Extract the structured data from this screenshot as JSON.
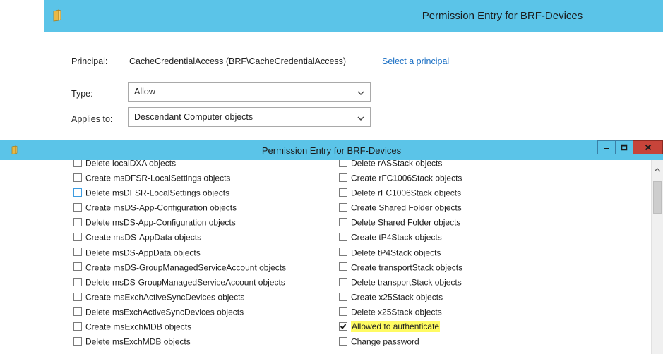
{
  "back_window": {
    "title": "Permission Entry for BRF-Devices",
    "principal_label": "Principal:",
    "principal_value": "CacheCredentialAccess (BRF\\CacheCredentialAccess)",
    "select_principal_link": "Select a principal",
    "type_label": "Type:",
    "type_value": "Allow",
    "applies_label": "Applies to:",
    "applies_value": "Descendant Computer objects"
  },
  "front_window": {
    "title": "Permission Entry for BRF-Devices",
    "left_column": [
      {
        "label": "Delete localDXA objects",
        "checked": false
      },
      {
        "label": "Create msDFSR-LocalSettings objects",
        "checked": false
      },
      {
        "label": "Delete msDFSR-LocalSettings objects",
        "checked": false,
        "focused": true
      },
      {
        "label": "Create msDS-App-Configuration objects",
        "checked": false
      },
      {
        "label": "Delete msDS-App-Configuration objects",
        "checked": false
      },
      {
        "label": "Create msDS-AppData objects",
        "checked": false
      },
      {
        "label": "Delete msDS-AppData objects",
        "checked": false
      },
      {
        "label": "Create msDS-GroupManagedServiceAccount objects",
        "checked": false
      },
      {
        "label": "Delete msDS-GroupManagedServiceAccount objects",
        "checked": false
      },
      {
        "label": "Create msExchActiveSyncDevices objects",
        "checked": false
      },
      {
        "label": "Delete msExchActiveSyncDevices objects",
        "checked": false
      },
      {
        "label": "Create msExchMDB objects",
        "checked": false
      },
      {
        "label": "Delete msExchMDB objects",
        "checked": false
      }
    ],
    "right_column": [
      {
        "label": "Delete rASStack objects",
        "checked": false
      },
      {
        "label": "Create rFC1006Stack objects",
        "checked": false
      },
      {
        "label": "Delete rFC1006Stack objects",
        "checked": false
      },
      {
        "label": "Create Shared Folder objects",
        "checked": false
      },
      {
        "label": "Delete Shared Folder objects",
        "checked": false
      },
      {
        "label": "Create tP4Stack objects",
        "checked": false
      },
      {
        "label": "Delete tP4Stack objects",
        "checked": false
      },
      {
        "label": "Create transportStack objects",
        "checked": false
      },
      {
        "label": "Delete transportStack objects",
        "checked": false
      },
      {
        "label": "Create x25Stack objects",
        "checked": false
      },
      {
        "label": "Delete x25Stack objects",
        "checked": false
      },
      {
        "label": "Allowed to authenticate",
        "checked": true,
        "highlighted": true
      },
      {
        "label": "Change password",
        "checked": false
      }
    ]
  },
  "colors": {
    "titlebar": "#5bc4e8",
    "close_button": "#c7443a",
    "link": "#1a6fc4",
    "highlight": "#fffb63"
  }
}
